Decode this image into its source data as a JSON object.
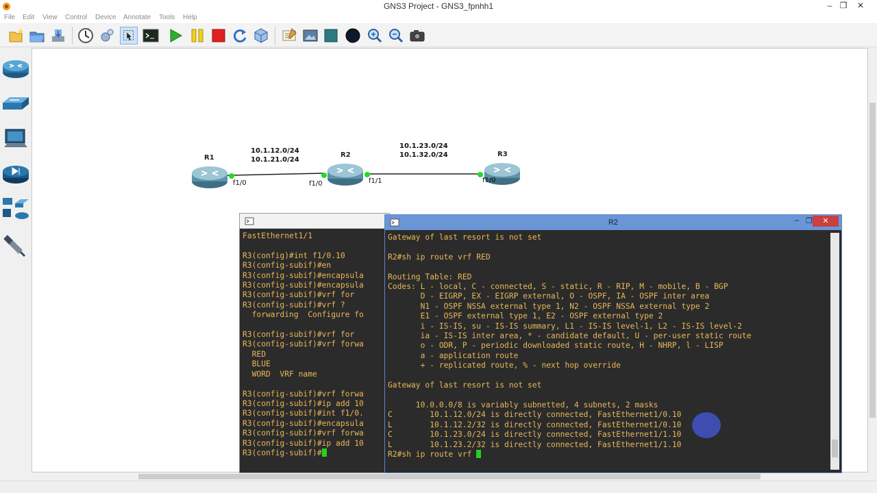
{
  "window": {
    "title": "GNS3 Project - GNS3_fpnhh1",
    "controls": {
      "minimize": "–",
      "restore": "❐",
      "close": "✕"
    }
  },
  "menu": [
    "File",
    "Edit",
    "View",
    "Control",
    "Device",
    "Annotate",
    "Tools",
    "Help"
  ],
  "toolbar": {
    "icons": [
      "new-project-icon",
      "open-project-icon",
      "save-project-icon",
      "snapshot-icon",
      "preferences-icon",
      "select-icon",
      "console-all-icon",
      "start-all-icon",
      "suspend-all-icon",
      "stop-all-icon",
      "reload-all-icon",
      "virtualbox-icon",
      "add-note-icon",
      "insert-picture-icon",
      "draw-rectangle-icon",
      "draw-ellipse-icon",
      "zoom-in-icon",
      "zoom-out-icon",
      "screenshot-icon"
    ]
  },
  "dock": [
    "routers-icon",
    "switches-icon",
    "end-devices-icon",
    "security-devices-icon",
    "all-devices-icon",
    "add-link-icon"
  ],
  "topology": {
    "routers": [
      {
        "name": "R1"
      },
      {
        "name": "R2"
      },
      {
        "name": "R3"
      }
    ],
    "links": [
      {
        "net1": "10.1.12.0/24",
        "net2": "10.1.21.0/24",
        "a_iface": "f1/0",
        "b_iface": "f1/0"
      },
      {
        "net1": "10.1.23.0/24",
        "net2": "10.1.32.0/24",
        "a_iface": "f1/1",
        "b_iface": "f1/0"
      }
    ],
    "colors": {
      "link": "#222222",
      "port_up": "#22dd22"
    }
  },
  "consoles": {
    "r3": {
      "title": "",
      "lines": [
        "FastEthernet1/1",
        "",
        "R3(config)#int f1/0.10",
        "R3(config-subif)#en",
        "R3(config-subif)#encapsula",
        "R3(config-subif)#encapsula",
        "R3(config-subif)#vrf for",
        "R3(config-subif)#vrf ?",
        "  forwarding  Configure fo",
        "",
        "R3(config-subif)#vrf for",
        "R3(config-subif)#vrf forwa",
        "  RED",
        "  BLUE",
        "  WORD  VRF name",
        "",
        "R3(config-subif)#vrf forwa",
        "R3(config-subif)#ip add 10",
        "R3(config-subif)#int f1/0.",
        "R3(config-subif)#encapsula",
        "R3(config-subif)#vrf forwa",
        "R3(config-subif)#ip add 10"
      ],
      "prompt": "R3(config-subif)#"
    },
    "r2": {
      "title": "R2",
      "lines": [
        "Gateway of last resort is not set",
        "",
        "R2#sh ip route vrf RED",
        "",
        "Routing Table: RED",
        "Codes: L - local, C - connected, S - static, R - RIP, M - mobile, B - BGP",
        "       D - EIGRP, EX - EIGRP external, O - OSPF, IA - OSPF inter area",
        "       N1 - OSPF NSSA external type 1, N2 - OSPF NSSA external type 2",
        "       E1 - OSPF external type 1, E2 - OSPF external type 2",
        "       i - IS-IS, su - IS-IS summary, L1 - IS-IS level-1, L2 - IS-IS level-2",
        "       ia - IS-IS inter area, * - candidate default, U - per-user static route",
        "       o - ODR, P - periodic downloaded static route, H - NHRP, l - LISP",
        "       a - application route",
        "       + - replicated route, % - next hop override",
        "",
        "Gateway of last resort is not set",
        "",
        "      10.0.0.0/8 is variably subnetted, 4 subnets, 2 masks",
        "C        10.1.12.0/24 is directly connected, FastEthernet1/0.10",
        "L        10.1.12.2/32 is directly connected, FastEthernet1/0.10",
        "C        10.1.23.0/24 is directly connected, FastEthernet1/1.10",
        "L        10.1.23.2/32 is directly connected, FastEthernet1/1.10"
      ],
      "prompt": "R2#sh ip route vrf "
    }
  }
}
